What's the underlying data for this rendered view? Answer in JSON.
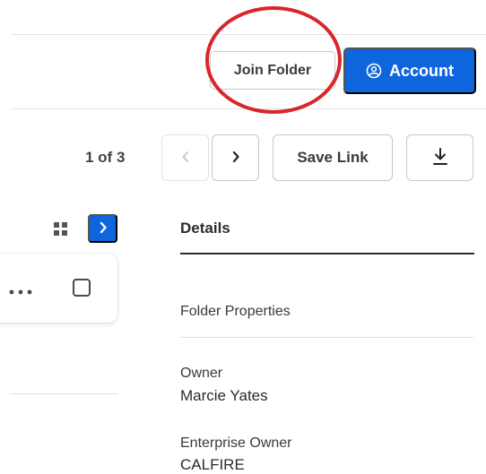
{
  "header": {
    "join_folder_label": "Join Folder",
    "account_label": "Account"
  },
  "toolbar": {
    "pager_text": "1 of 3",
    "save_link_label": "Save Link"
  },
  "details": {
    "title": "Details",
    "folder_properties_label": "Folder Properties",
    "owner_label": "Owner",
    "owner_value": "Marcie Yates",
    "enterprise_owner_label": "Enterprise Owner",
    "enterprise_owner_value": "CALFIRE"
  },
  "icons": {
    "account": "user-circle-icon",
    "prev": "chevron-left-icon",
    "next": "chevron-right-icon",
    "download": "download-icon",
    "grid": "grid-view-icon",
    "expand": "chevron-right-icon",
    "more": "more-horizontal-icon",
    "checkbox": "checkbox-icon"
  },
  "colors": {
    "primary": "#0f66dc",
    "annotation": "#d9262a"
  }
}
